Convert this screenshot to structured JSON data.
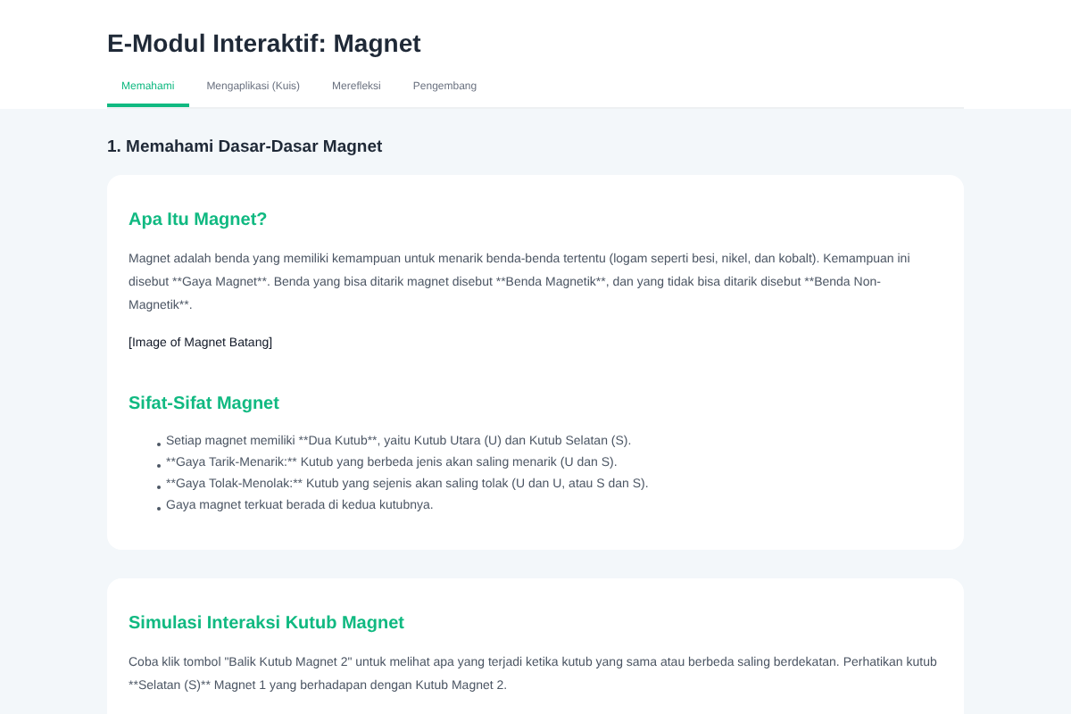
{
  "header": {
    "title": "E-Modul Interaktif: Magnet"
  },
  "tabs": [
    {
      "label": "Memahami",
      "selected": true
    },
    {
      "label": "Mengaplikasi (Kuis)",
      "selected": false
    },
    {
      "label": "Merefleksi",
      "selected": false
    },
    {
      "label": "Pengembang",
      "selected": false
    }
  ],
  "section_title": "1. Memahami Dasar-Dasar Magnet",
  "cards": [
    {
      "blocks": [
        {
          "kind": "heading",
          "text": "Apa Itu Magnet?"
        },
        {
          "kind": "paragraph",
          "text": "Magnet adalah benda yang memiliki kemampuan untuk menarik benda-benda tertentu (logam seperti besi, nikel, dan kobalt). Kemampuan ini disebut **Gaya Magnet**. Benda yang bisa ditarik magnet disebut **Benda Magnetik**, dan yang tidak bisa ditarik disebut **Benda Non-Magnetik**."
        },
        {
          "kind": "note",
          "text": "[Image of Magnet Batang]"
        },
        {
          "kind": "heading",
          "text": "Sifat-Sifat Magnet"
        },
        {
          "kind": "list",
          "items": [
            "Setiap magnet memiliki **Dua Kutub**, yaitu Kutub Utara (U) dan Kutub Selatan (S).",
            "**Gaya Tarik-Menarik:** Kutub yang berbeda jenis akan saling menarik (U dan S).",
            "**Gaya Tolak-Menolak:** Kutub yang sejenis akan saling tolak (U dan U, atau S dan S).",
            "Gaya magnet terkuat berada di kedua kutubnya."
          ]
        }
      ]
    },
    {
      "blocks": [
        {
          "kind": "heading",
          "text": "Simulasi Interaksi Kutub Magnet"
        },
        {
          "kind": "paragraph",
          "text": "Coba klik tombol \"Balik Kutub Magnet 2\" untuk melihat apa yang terjadi ketika kutub yang sama atau berbeda saling berdekatan. Perhatikan kutub **Selatan (S)** Magnet 1 yang berhadapan dengan Kutub Magnet 2."
        }
      ]
    }
  ]
}
